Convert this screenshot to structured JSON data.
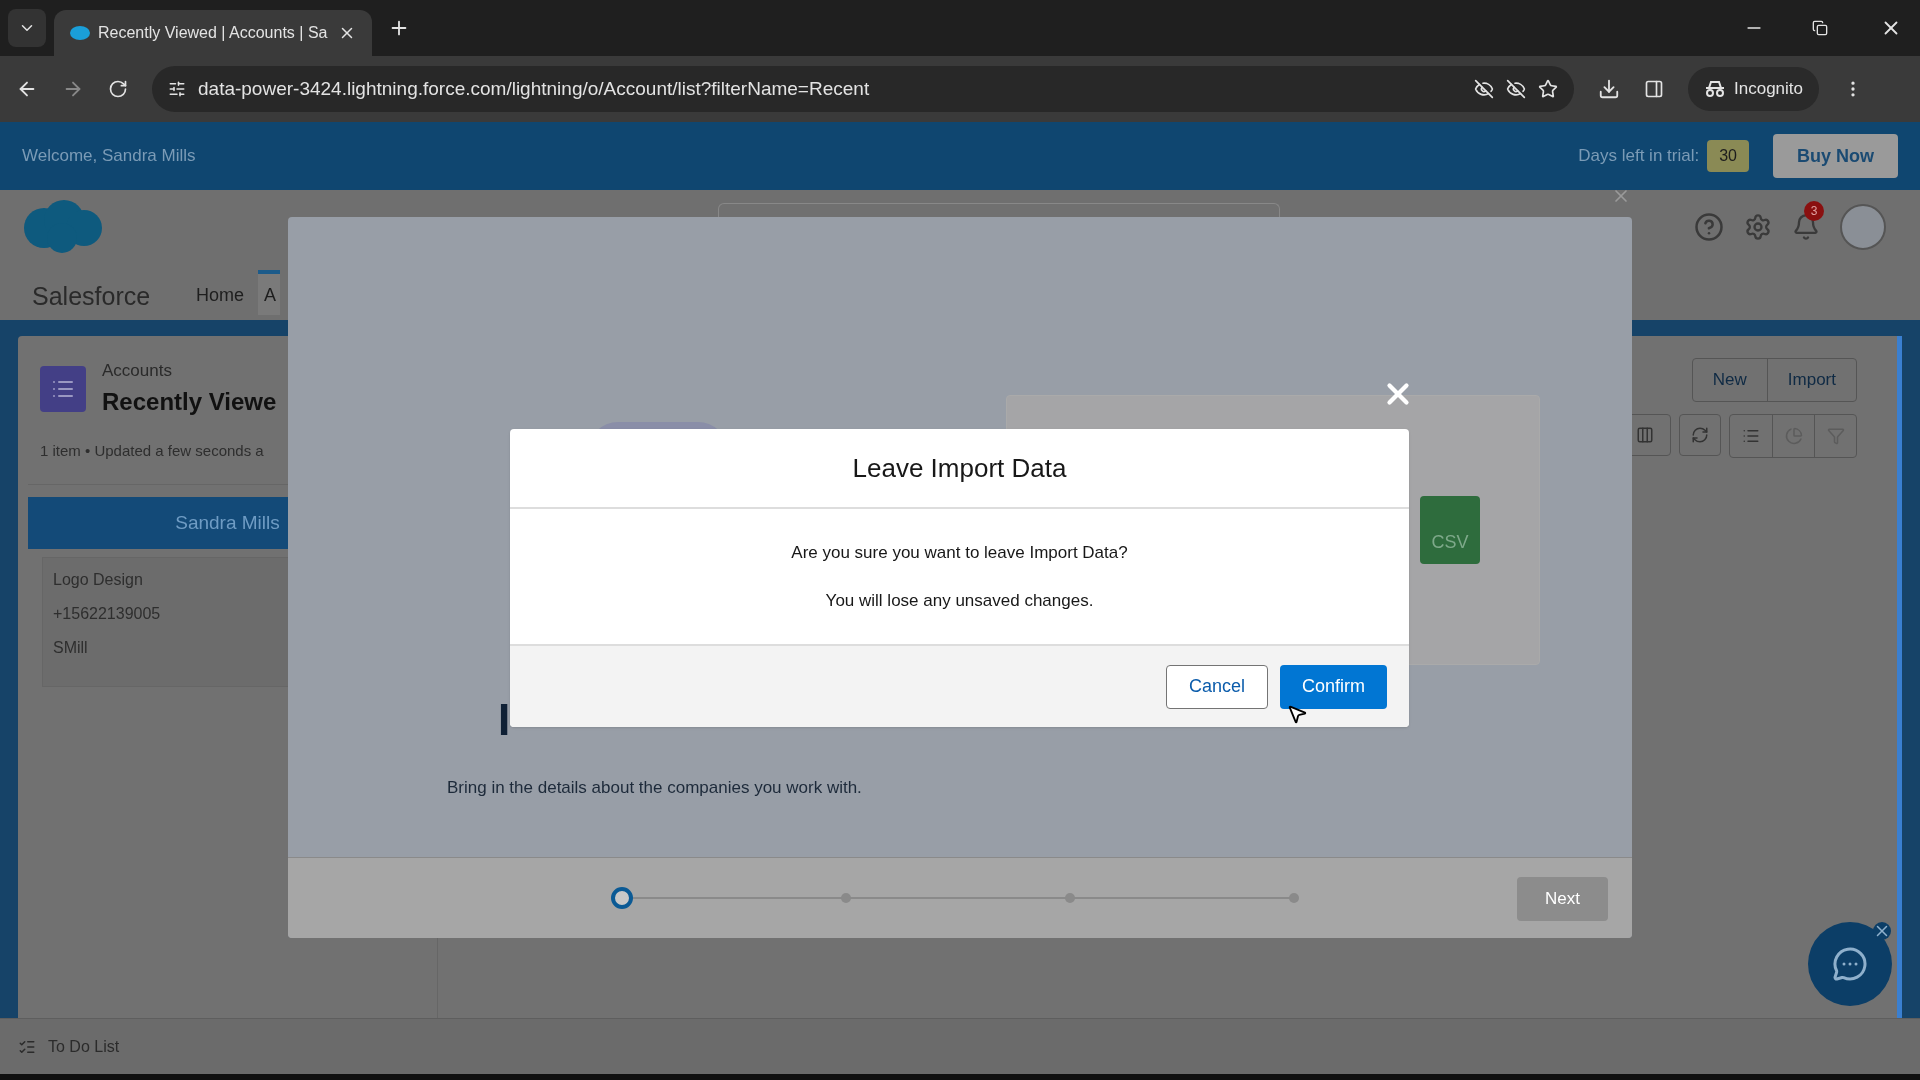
{
  "browser": {
    "tab_title": "Recently Viewed | Accounts | Sa",
    "url": "data-power-3424.lightning.force.com/lightning/o/Account/list?filterName=Recent",
    "profile": "Incognito"
  },
  "trial_bar": {
    "welcome": "Welcome, Sandra Mills",
    "days_label": "Days left in trial:",
    "days": "30",
    "buy_now": "Buy Now"
  },
  "app": {
    "name": "Salesforce",
    "nav_items": [
      {
        "label": "Home",
        "selected": false
      },
      {
        "label": "A",
        "selected": true
      }
    ],
    "notifications": "3"
  },
  "list_view": {
    "object": "Accounts",
    "title": "Recently Viewe",
    "meta": "1 item • Updated a few seconds a",
    "actions": [
      "New",
      "Import"
    ],
    "card": {
      "header": "Sandra Mills",
      "lines": [
        "Logo Design",
        "+15622139005",
        "SMill"
      ]
    }
  },
  "import_wizard": {
    "heading": "I",
    "file_type": "CSV",
    "description": "Bring in the details about the companies you work with.",
    "steps": [
      {
        "selected": true
      },
      {
        "selected": false
      },
      {
        "selected": false
      },
      {
        "selected": false
      }
    ],
    "next": {
      "label": "Next",
      "disabled": true
    }
  },
  "dialog": {
    "title": "Leave Import Data",
    "messages": [
      "Are you sure you want to leave Import Data?",
      "You will lose any unsaved changes."
    ],
    "cancel": "Cancel",
    "confirm": "Confirm"
  },
  "footer": {
    "todo": "To Do List"
  }
}
